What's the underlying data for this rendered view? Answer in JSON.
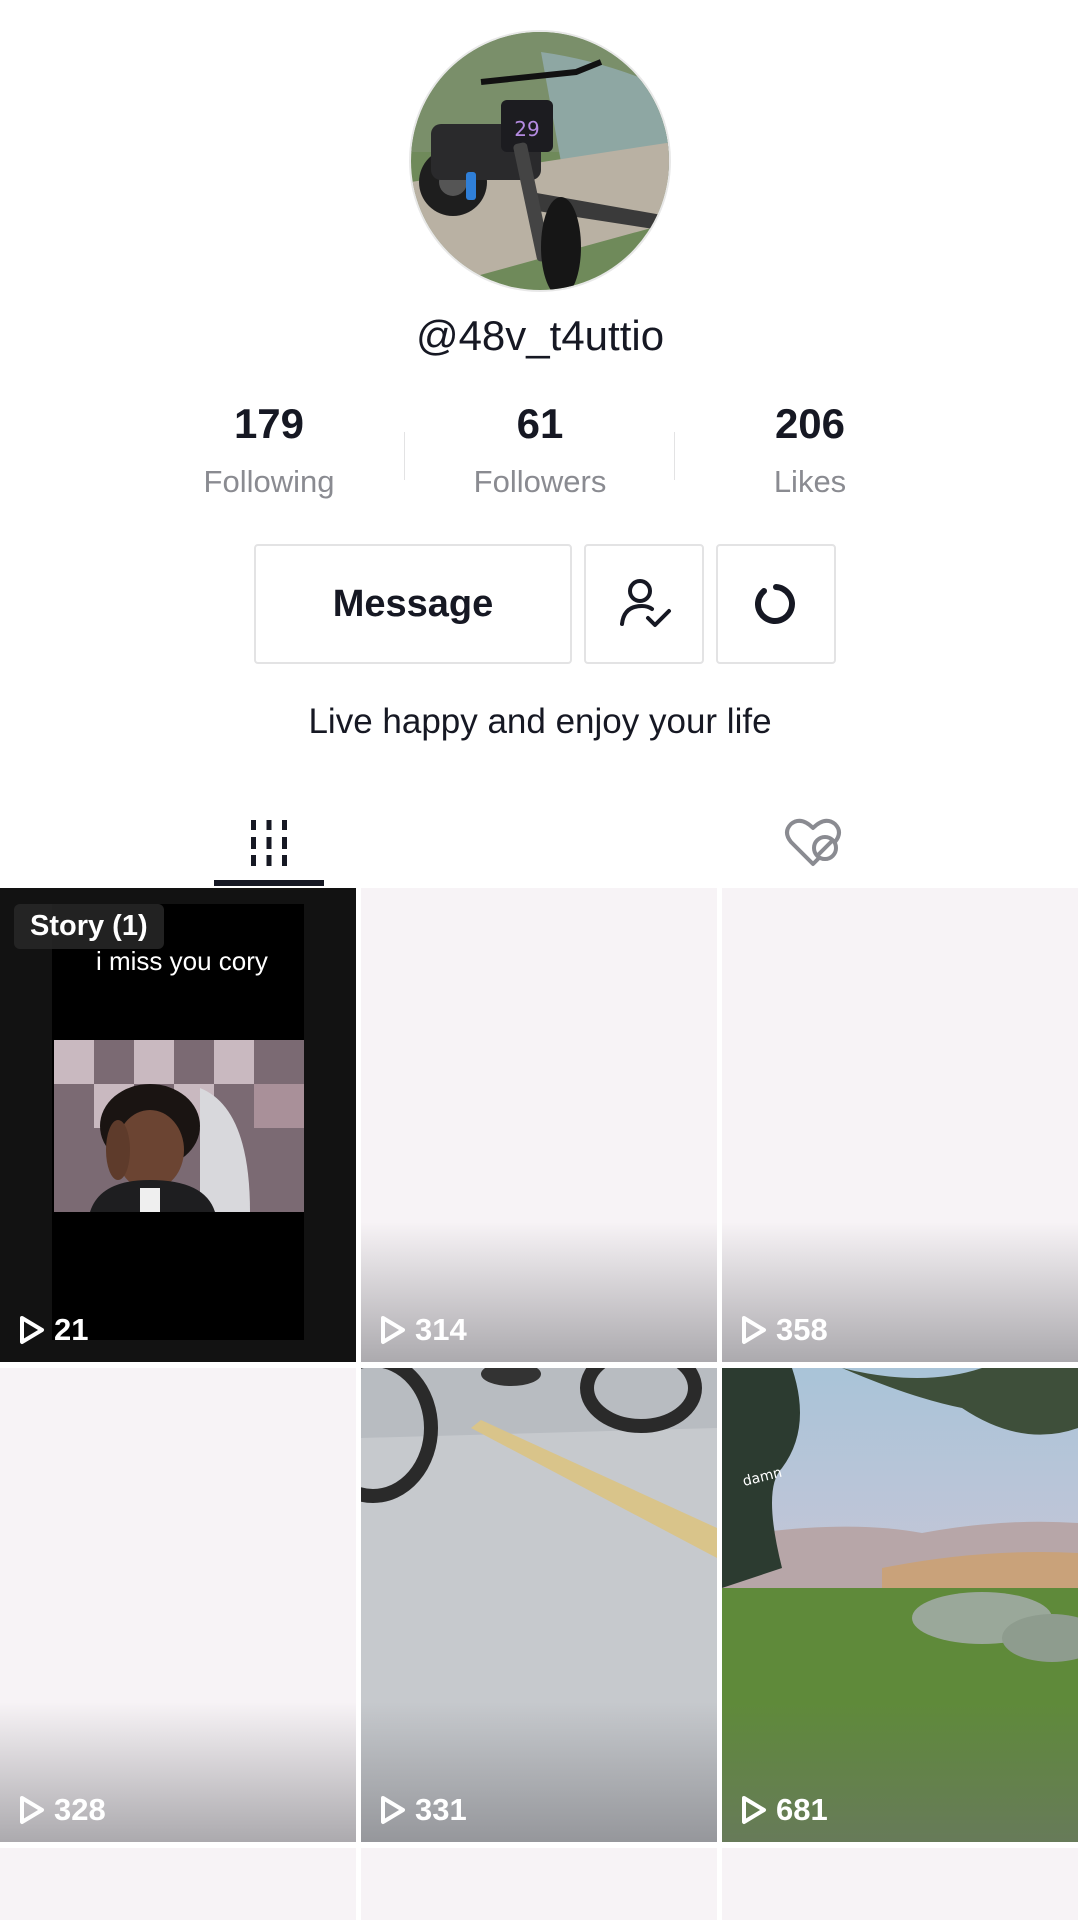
{
  "profile": {
    "username": "@48v_t4uttio",
    "bio": "Live happy and enjoy your life",
    "avatar_icon": "dirt-bike-avatar",
    "avatar_number": "29"
  },
  "stats": [
    {
      "value": "179",
      "label": "Following"
    },
    {
      "value": "61",
      "label": "Followers"
    },
    {
      "value": "206",
      "label": "Likes"
    }
  ],
  "actions": {
    "message_label": "Message",
    "follow_icon": "user-check-icon",
    "more_icon": "refresh-icon"
  },
  "tabs": [
    {
      "icon": "grid-icon",
      "active": true
    },
    {
      "icon": "liked-hidden-icon",
      "active": false
    }
  ],
  "videos": [
    {
      "views": "21",
      "story_badge": "Story (1)",
      "caption": "i miss you cory"
    },
    {
      "views": "314"
    },
    {
      "views": "358"
    },
    {
      "views": "328"
    },
    {
      "views": "331"
    },
    {
      "views": "681",
      "overlay_text": "damn"
    }
  ],
  "colors": {
    "text_primary": "#161823",
    "text_secondary": "#8a8b91",
    "border": "#e3e3e4"
  }
}
